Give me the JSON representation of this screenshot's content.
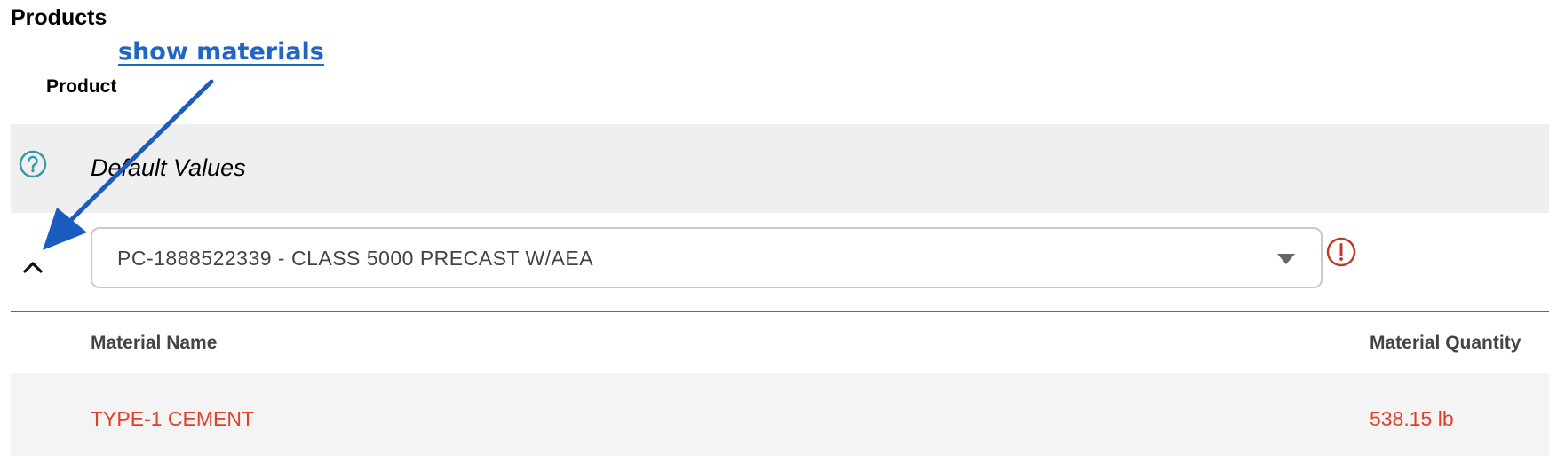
{
  "section": {
    "title": "Products"
  },
  "table": {
    "column_product": "Product"
  },
  "default_row": {
    "label": "Default Values",
    "icon": "help-circle-icon",
    "icon_color": "#3a98a8"
  },
  "product_row": {
    "selected_product": "PC-1888522339 - CLASS 5000 PRECAST W/AEA",
    "expand_icon": "chevron-up-icon",
    "status_icon": "error-circle-icon",
    "status_color": "#c0392b"
  },
  "materials": {
    "headers": {
      "name": "Material Name",
      "quantity": "Material Quantity"
    },
    "rows": [
      {
        "name": "TYPE-1 CEMENT",
        "quantity": "538.15 lb"
      }
    ],
    "row_color": "#e0402a"
  },
  "annotation": {
    "text": "show materials",
    "color": "#2266c4"
  }
}
